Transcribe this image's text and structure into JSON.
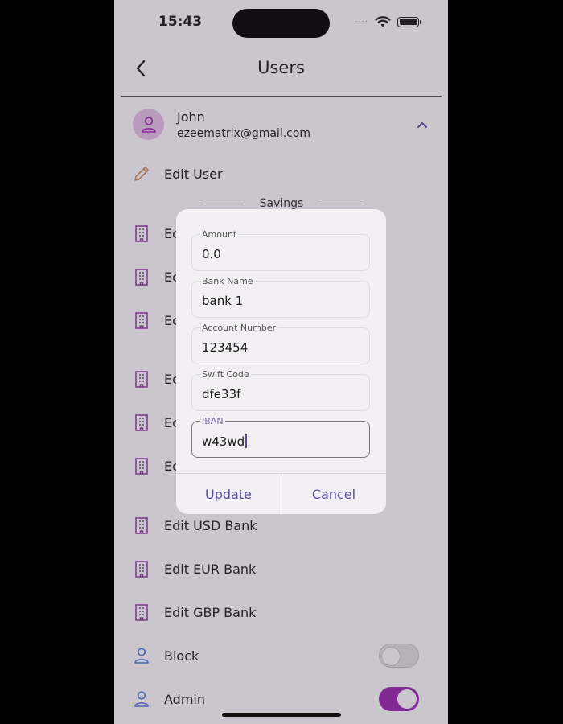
{
  "status_bar": {
    "time": "15:43",
    "signal_dots": "····"
  },
  "header": {
    "title": "Users"
  },
  "user": {
    "name": "John",
    "email": "ezeematrix@gmail.com"
  },
  "edit_user_label": "Edit User",
  "section": {
    "label": "Savings"
  },
  "bank_rows_hidden": [
    {
      "label": "Ec"
    },
    {
      "label": "Ec"
    },
    {
      "label": "Ec"
    },
    {
      "label": "Ec"
    },
    {
      "label": "Ec"
    },
    {
      "label": "Ec"
    }
  ],
  "bank_rows": [
    {
      "label": "Edit USD Bank"
    },
    {
      "label": "Edit EUR Bank"
    },
    {
      "label": "Edit GBP Bank"
    }
  ],
  "toggles": [
    {
      "label": "Block",
      "on": false
    },
    {
      "label": "Admin",
      "on": true
    }
  ],
  "dialog": {
    "fields": [
      {
        "label": "Amount",
        "value": "0.0"
      },
      {
        "label": "Bank Name",
        "value": "bank 1"
      },
      {
        "label": "Account Number",
        "value": "123454"
      },
      {
        "label": "Swift Code",
        "value": "dfe33f"
      },
      {
        "label": "IBAN",
        "value": "w43wd"
      }
    ],
    "update_label": "Update",
    "cancel_label": "Cancel"
  },
  "colors": {
    "accent": "#9c27b0",
    "bank_icon": "#8e3a9e",
    "person_icon": "#4a7fd0",
    "dialog_button": "#5b4fa0"
  }
}
